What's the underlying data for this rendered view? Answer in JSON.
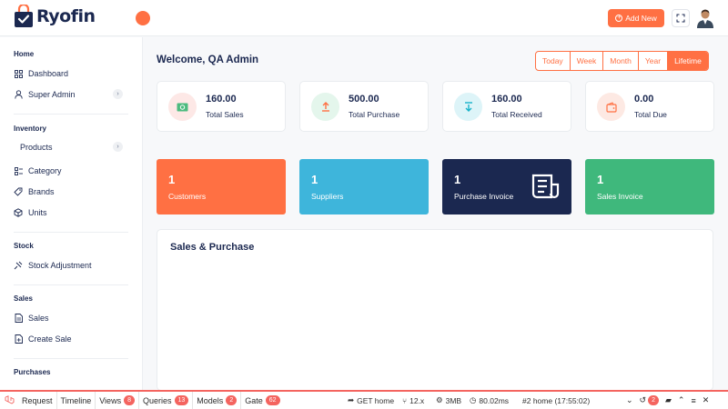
{
  "brand": {
    "name": "Ryofin"
  },
  "header": {
    "add_new_label": "Add New"
  },
  "sidebar": {
    "sections": [
      {
        "title": "Home",
        "items": [
          {
            "label": "Dashboard",
            "icon": "grid-icon"
          },
          {
            "label": "Super Admin",
            "icon": "user-icon",
            "has_submenu": true
          }
        ]
      },
      {
        "title": "Inventory",
        "items": [
          {
            "label": "Products",
            "has_submenu": true
          },
          {
            "label": "Category",
            "icon": "category-icon"
          },
          {
            "label": "Brands",
            "icon": "tag-icon"
          },
          {
            "label": "Units",
            "icon": "box-icon"
          }
        ]
      },
      {
        "title": "Stock",
        "items": [
          {
            "label": "Stock Adjustment",
            "icon": "adjust-icon"
          }
        ]
      },
      {
        "title": "Sales",
        "items": [
          {
            "label": "Sales",
            "icon": "file-icon"
          },
          {
            "label": "Create Sale",
            "icon": "file-plus-icon"
          }
        ]
      },
      {
        "title": "Purchases",
        "items": []
      }
    ]
  },
  "main": {
    "welcome": "Welcome, QA Admin",
    "filters": [
      "Today",
      "Week",
      "Month",
      "Year",
      "Lifetime"
    ],
    "active_filter": "Lifetime",
    "stats": [
      {
        "value": "160.00",
        "label": "Total Sales",
        "icon": "cash-icon",
        "color": "#e05a4f",
        "bg": "#fde8e6"
      },
      {
        "value": "500.00",
        "label": "Total Purchase",
        "icon": "upload-icon",
        "color": "#ff7043",
        "bg": "#e4f6ec"
      },
      {
        "value": "160.00",
        "label": "Total Received",
        "icon": "download-icon",
        "color": "#17b3c9",
        "bg": "#ddf4f8"
      },
      {
        "value": "0.00",
        "label": "Total Due",
        "icon": "wallet-icon",
        "color": "#ff7043",
        "bg": "#fde9e3"
      }
    ],
    "cards": [
      {
        "count": "1",
        "label": "Customers",
        "color": "#ff7043"
      },
      {
        "count": "1",
        "label": "Suppliers",
        "color": "#3eb5db"
      },
      {
        "count": "1",
        "label": "Purchase Invoice",
        "color": "#1b2850",
        "icon": "invoice-icon"
      },
      {
        "count": "1",
        "label": "Sales Invoice",
        "color": "#3fb87c"
      }
    ],
    "chart_panel_title": "Sales & Purchase"
  },
  "debugbar": {
    "tabs": [
      {
        "label": "Request"
      },
      {
        "label": "Timeline"
      },
      {
        "label": "Views",
        "badge": "8"
      },
      {
        "label": "Queries",
        "badge": "13"
      },
      {
        "label": "Models",
        "badge": "2"
      },
      {
        "label": "Gate",
        "badge": "62"
      }
    ],
    "route": "GET home",
    "php": "12.x",
    "memory": "3MB",
    "time": "80.02ms",
    "request": "#2 home (17:55:02)",
    "history_badge": "2"
  }
}
